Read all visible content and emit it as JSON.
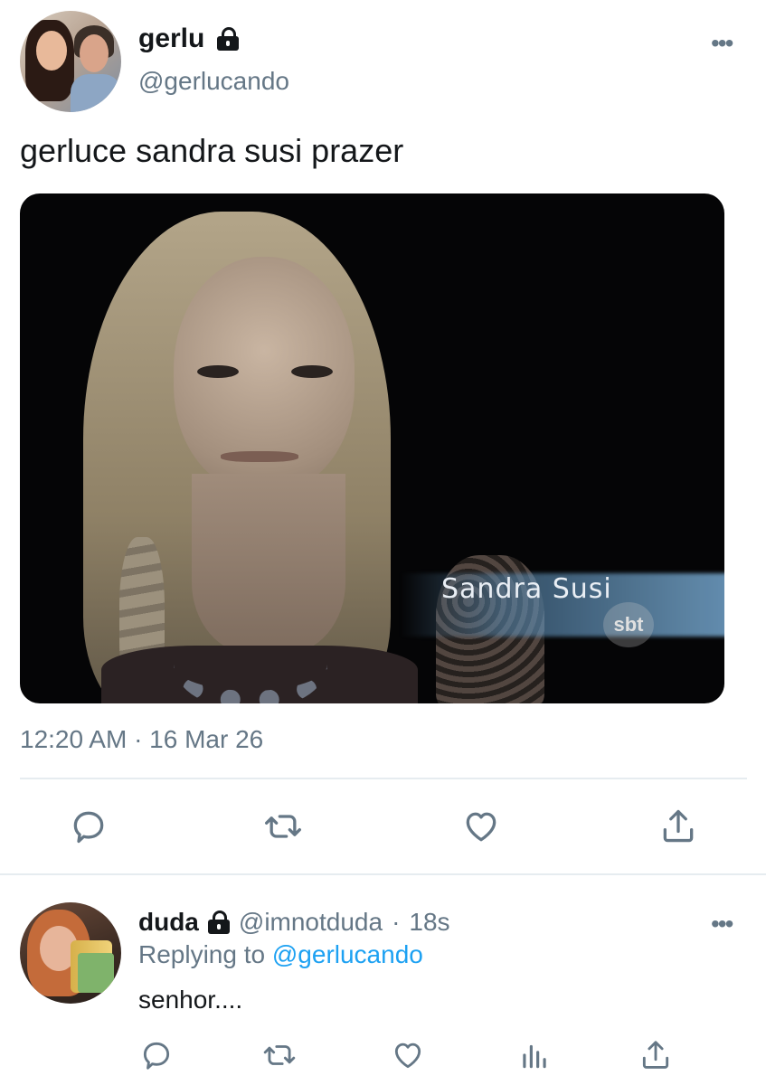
{
  "main_tweet": {
    "display_name": "gerlu",
    "handle": "@gerlucando",
    "text": "gerluce sandra susi prazer",
    "media_caption": "Sandra Susi",
    "media_logo": "sbt",
    "timestamp": "12:20 AM · 16 Mar 26",
    "more_label": "•••"
  },
  "reply_tweet": {
    "display_name": "duda",
    "handle": "@imnotduda",
    "separator": "·",
    "time": "18s",
    "replying_prefix": "Replying to",
    "replying_to": "@gerlucando",
    "text": "senhor....",
    "more_label": "•••"
  },
  "icons": {
    "reply": "reply-icon",
    "retweet": "retweet-icon",
    "like": "heart-icon",
    "share": "share-icon",
    "analytics": "analytics-icon",
    "lock": "lock-icon",
    "more": "more-icon"
  },
  "colors": {
    "text": "#14171a",
    "secondary": "#657786",
    "link": "#1da1f2",
    "divider": "#e6ecf0",
    "icon": "#657786"
  }
}
